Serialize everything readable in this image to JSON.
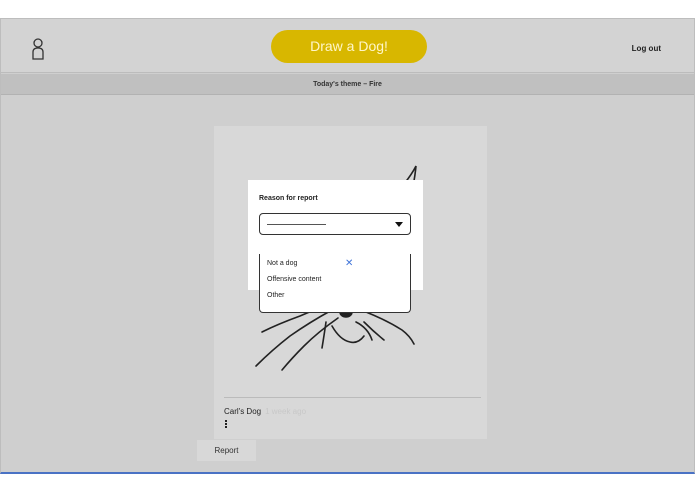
{
  "header": {
    "draw_button_label": "Draw a Dog!",
    "logout_label": "Log out",
    "theme_text": "Today's theme – Fire"
  },
  "post": {
    "author": "Carl's Dog",
    "posted_ago": "1 week ago",
    "report_label": "Report"
  },
  "report_modal": {
    "title": "Reason for report",
    "options": [
      "Not a dog",
      "Offensive content",
      "Other"
    ]
  },
  "colors": {
    "accent": "#d8b700",
    "close_icon": "#3f73d8",
    "bottom_border": "#4a72c4"
  }
}
